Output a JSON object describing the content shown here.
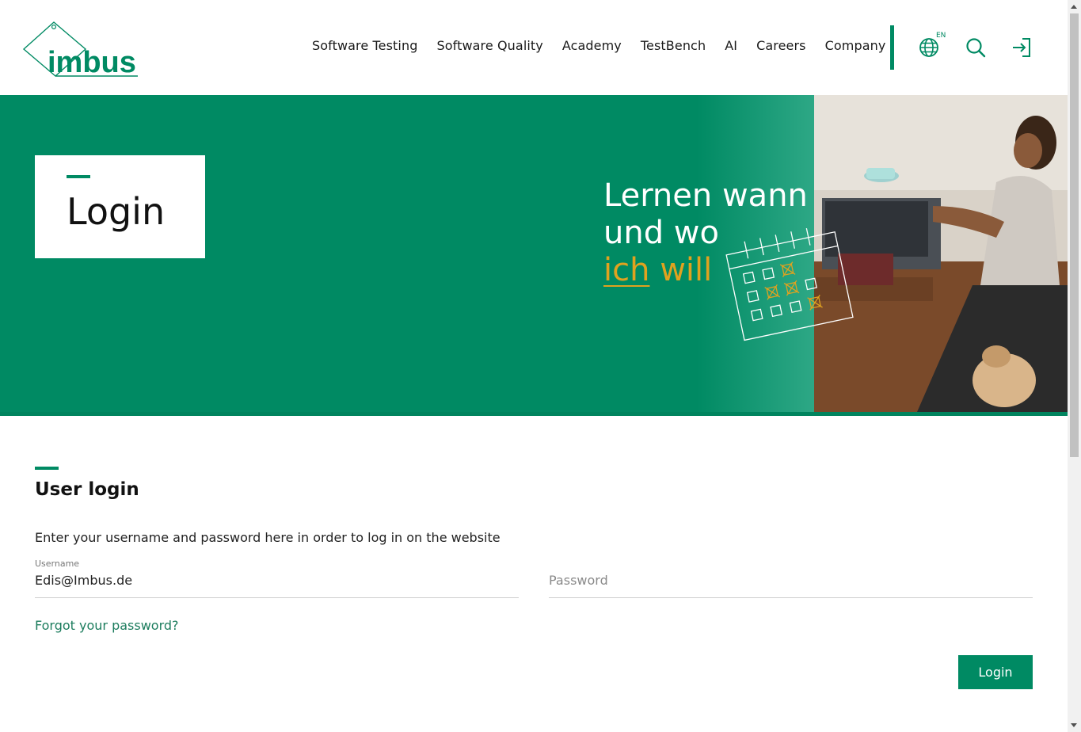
{
  "header": {
    "logo_text": "imbus",
    "nav": [
      "Software Testing",
      "Software Quality",
      "Academy",
      "TestBench",
      "AI",
      "Careers",
      "Company"
    ],
    "lang_code": "EN",
    "icons": [
      "globe-icon",
      "search-icon",
      "login-icon"
    ]
  },
  "hero": {
    "title": "Login",
    "slogan_line1": "Lernen wann",
    "slogan_line2": "und wo",
    "slogan_accent_underlined": "ich",
    "slogan_accent_rest": "will"
  },
  "login": {
    "heading": "User login",
    "description": "Enter your username and password here in order to log in on the website",
    "username_label": "Username",
    "username_value": "Edis@Imbus.de",
    "password_placeholder": "Password",
    "forgot_label": "Forgot your password?",
    "submit_label": "Login"
  },
  "colors": {
    "brand_green": "#008a63",
    "accent_gold": "#e0a21f",
    "link_green": "#1d7d5e"
  }
}
